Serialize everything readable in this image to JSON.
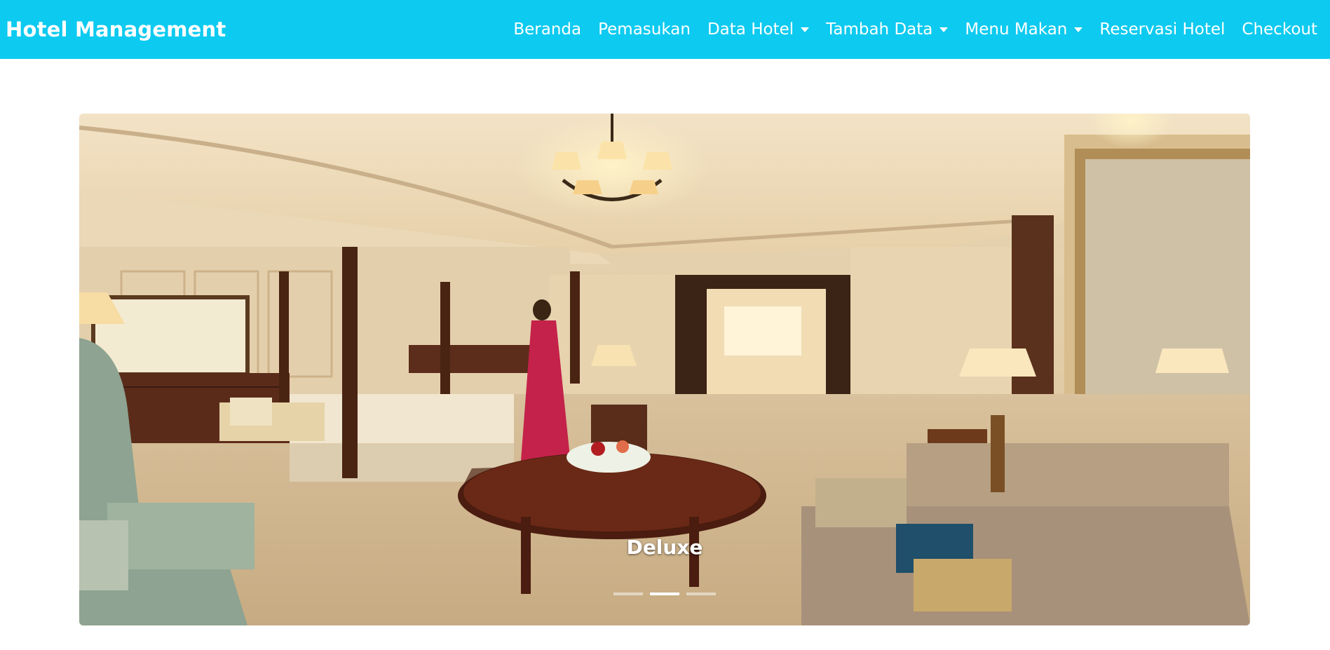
{
  "navbar": {
    "brand": "Hotel Management",
    "links": [
      {
        "label": "Beranda",
        "dropdown": false
      },
      {
        "label": "Pemasukan",
        "dropdown": false
      },
      {
        "label": "Data Hotel",
        "dropdown": true
      },
      {
        "label": "Tambah Data",
        "dropdown": true
      },
      {
        "label": "Menu Makan",
        "dropdown": true
      },
      {
        "label": "Reservasi Hotel",
        "dropdown": false
      },
      {
        "label": "Checkout",
        "dropdown": false
      }
    ],
    "color": "#0dcaf0"
  },
  "carousel": {
    "caption": "Deluxe",
    "slide_count": 3,
    "active_index": 1
  }
}
